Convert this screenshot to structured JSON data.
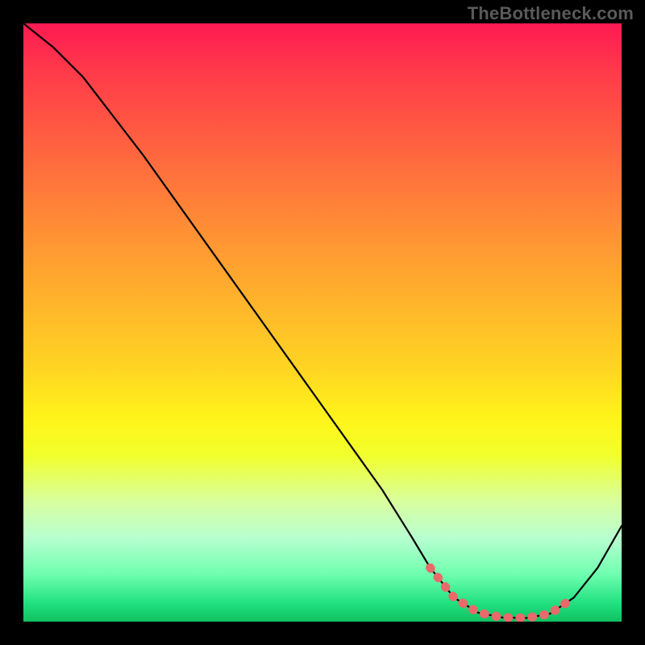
{
  "watermark": "TheBottleneck.com",
  "chart_data": {
    "type": "line",
    "title": "",
    "xlabel": "",
    "ylabel": "",
    "xlim": [
      0,
      100
    ],
    "ylim": [
      0,
      100
    ],
    "series": [
      {
        "name": "bottleneck-curve",
        "color": "#000000",
        "x": [
          0,
          5,
          10,
          15,
          20,
          25,
          30,
          35,
          40,
          45,
          50,
          55,
          60,
          65,
          68,
          72,
          76,
          80,
          84,
          88,
          92,
          96,
          100
        ],
        "values": [
          100,
          96,
          91,
          84.5,
          78,
          71,
          64,
          57,
          50,
          43,
          36,
          29,
          22,
          14,
          9,
          4,
          1.5,
          0.7,
          0.6,
          1.3,
          4,
          9,
          16
        ]
      },
      {
        "name": "highlight-segment",
        "color": "#e86a6a",
        "x": [
          68,
          72,
          76,
          80,
          84,
          88,
          92
        ],
        "values": [
          9,
          4,
          1.5,
          0.7,
          0.6,
          1.3,
          4
        ]
      }
    ],
    "gradient_stops": [
      {
        "pos": 0,
        "color": "#ff1a52"
      },
      {
        "pos": 8,
        "color": "#ff3a4a"
      },
      {
        "pos": 18,
        "color": "#ff5a42"
      },
      {
        "pos": 28,
        "color": "#ff7a3a"
      },
      {
        "pos": 38,
        "color": "#ff9a32"
      },
      {
        "pos": 48,
        "color": "#ffb82a"
      },
      {
        "pos": 58,
        "color": "#ffd622"
      },
      {
        "pos": 66,
        "color": "#fff41a"
      },
      {
        "pos": 72,
        "color": "#f2ff2a"
      },
      {
        "pos": 80,
        "color": "#d8ffa0"
      },
      {
        "pos": 86,
        "color": "#b8ffd0"
      },
      {
        "pos": 92,
        "color": "#70ffb0"
      },
      {
        "pos": 97,
        "color": "#20e080"
      },
      {
        "pos": 100,
        "color": "#10c060"
      }
    ]
  }
}
